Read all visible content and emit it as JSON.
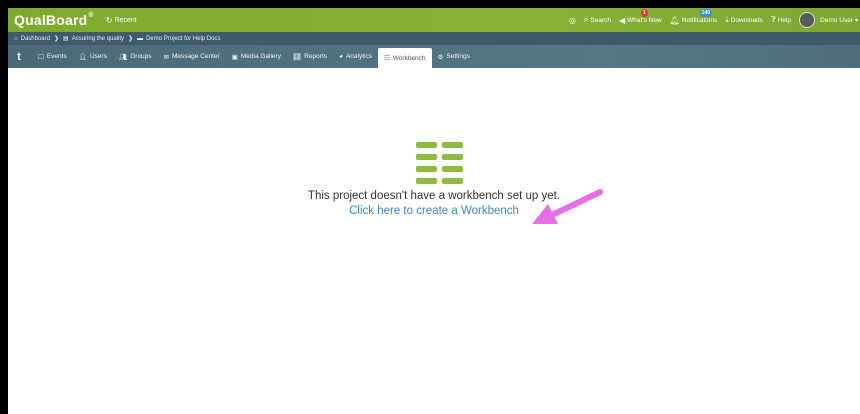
{
  "app": {
    "brand": "QualBoard",
    "brand_mark": "®",
    "recent_label": "Recent"
  },
  "topnav": {
    "items": [
      {
        "label": "Search",
        "icon": "search-icon"
      },
      {
        "label": "What's New",
        "icon": "megaphone-icon",
        "badge": "1"
      },
      {
        "label": "Notifications",
        "icon": "bell-icon",
        "badge": "140"
      },
      {
        "label": "Downloads",
        "icon": "download-icon"
      },
      {
        "label": "Help",
        "icon": "help-icon"
      },
      {
        "label": "Demo User",
        "icon": "avatar"
      }
    ]
  },
  "breadcrumb": {
    "items": [
      "Dashboard",
      "Assuring the quality",
      "Demo Project for Help Docs"
    ]
  },
  "nav": {
    "tabs": [
      {
        "label": "Events",
        "icon": "calendar-icon"
      },
      {
        "label": "Users",
        "icon": "user-icon"
      },
      {
        "label": "Groups",
        "icon": "groups-icon"
      },
      {
        "label": "Message Center",
        "icon": "envelope-icon"
      },
      {
        "label": "Media Gallery",
        "icon": "gallery-icon"
      },
      {
        "label": "Reports",
        "icon": "chart-icon"
      },
      {
        "label": "Analytics",
        "icon": "analytics-icon"
      },
      {
        "label": "Workbench",
        "icon": "workbench-icon",
        "active": true
      },
      {
        "label": "Settings",
        "icon": "gear-icon"
      }
    ]
  },
  "main": {
    "empty_message": "This project doesn't have a workbench set up yet.",
    "create_link": "Click here to create a Workbench"
  },
  "colors": {
    "brand_green": "#88b336",
    "nav_slate": "#4a6a7a",
    "link_blue": "#3a88c8",
    "annotation_arrow": "#e86ee6"
  }
}
